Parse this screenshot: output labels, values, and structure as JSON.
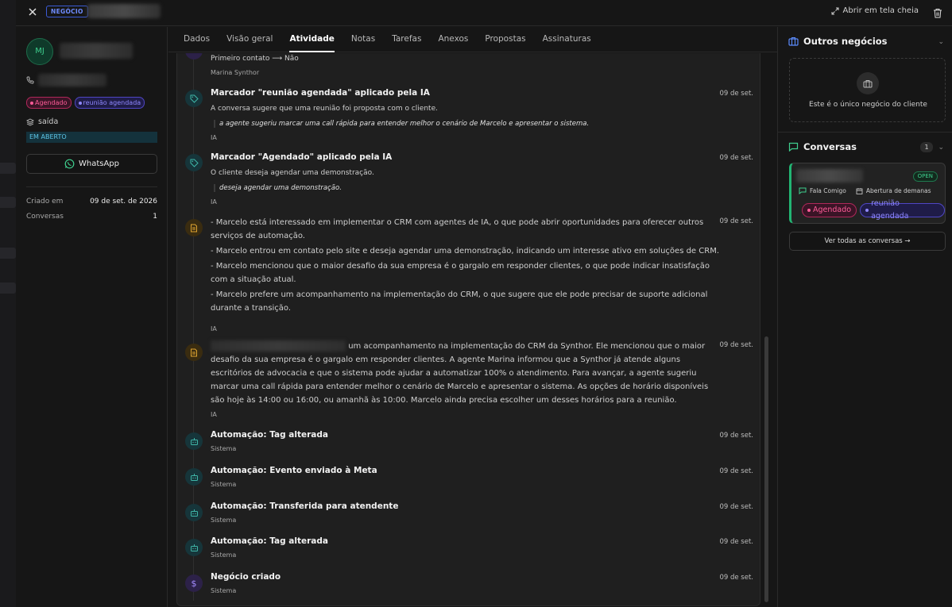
{
  "topbar": {
    "badge": "NEGÓCIO",
    "fullscreen_label": "Abrir em tela cheia"
  },
  "contact": {
    "initials": "MJ",
    "tags": [
      {
        "label": "Agendado",
        "color": "#ff5c98"
      },
      {
        "label": "reunião agendada",
        "color": "#8f88ff"
      }
    ],
    "stage": "saída",
    "status": "EM ABERTO",
    "whatsapp_label": "WhatsApp",
    "created_label": "Criado em",
    "created_value": "09 de set. de 2026",
    "conversations_label": "Conversas",
    "conversations_value": "1"
  },
  "tabs": [
    {
      "label": "Dados",
      "active": false
    },
    {
      "label": "Visão geral",
      "active": false
    },
    {
      "label": "Atividade",
      "active": true
    },
    {
      "label": "Notas",
      "active": false
    },
    {
      "label": "Tarefas",
      "active": false
    },
    {
      "label": "Anexos",
      "active": false
    },
    {
      "label": "Propostas",
      "active": false
    },
    {
      "label": "Assinaturas",
      "active": false
    }
  ],
  "timeline": {
    "partial_top": {
      "desc": "Primeiro contato ⟶ Não",
      "author": "Marina Synthor"
    },
    "entries": [
      {
        "title": "Marcador \"reunião agendada\" aplicado pela IA",
        "date": "09 de set.",
        "desc": "A conversa sugere que uma reunião foi proposta com o cliente.",
        "quote": "a agente sugeriu marcar uma call rápida para entender melhor o cenário de Marcelo e apresentar o sistema.",
        "author": "IA"
      },
      {
        "title": "Marcador \"Agendado\" aplicado pela IA",
        "date": "09 de set.",
        "desc": "O cliente deseja agendar uma demonstração.",
        "quote": "deseja agendar uma demonstração.",
        "author": "IA"
      },
      {
        "date": "09 de set.",
        "bullets": [
          "- Marcelo está interessado em implementar o CRM com agentes de IA, o que pode abrir oportunidades para oferecer outros serviços de automação.",
          "- Marcelo entrou em contato pelo site e deseja agendar uma demonstração, indicando um interesse ativo em soluções de CRM.",
          "- Marcelo mencionou que o maior desafio da sua empresa é o gargalo em responder clientes, o que pode indicar insatisfação com a situação atual.",
          "- Marcelo prefere um acompanhamento na implementação do CRM, o que sugere que ele pode precisar de suporte adicional durante a transição."
        ],
        "author": "IA"
      },
      {
        "date": "09 de set.",
        "summary": "um acompanhamento na implementação do CRM da Synthor. Ele mencionou que o maior desafio da sua empresa é o gargalo em responder clientes. A agente Marina informou que a Synthor já atende alguns escritórios de advocacia e que o sistema pode ajudar a automatizar 100% o atendimento. Para avançar, a agente sugeriu marcar uma call rápida para entender melhor o cenário de Marcelo e apresentar o sistema. As opções de horário disponíveis são hoje às 14:00 ou 16:00, ou amanhã às 10:00. Marcelo ainda precisa escolher um desses horários para a reunião.",
        "author": "IA"
      },
      {
        "title": "Automação: Tag alterada",
        "date": "09 de set.",
        "author": "Sistema"
      },
      {
        "title": "Automação: Evento enviado à Meta",
        "date": "09 de set.",
        "author": "Sistema"
      },
      {
        "title": "Automação: Transferida para atendente",
        "date": "09 de set.",
        "author": "Sistema"
      },
      {
        "title": "Automação: Tag alterada",
        "date": "09 de set.",
        "author": "Sistema"
      },
      {
        "title": "Negócio criado",
        "date": "09 de set.",
        "author": "Sistema"
      }
    ]
  },
  "right": {
    "other_deals_title": "Outros negócios",
    "other_deals_empty": "Este é o único negócio do cliente",
    "conversations_title": "Conversas",
    "conversations_count": "1",
    "conversation": {
      "status": "OPEN",
      "channel": "Fala Comigo",
      "department": "Abertura de demanas",
      "tags": [
        {
          "label": "Agendado",
          "color": "#ff5c98"
        },
        {
          "label": "reunião agendada",
          "color": "#8f88ff"
        }
      ]
    },
    "view_all_label": "Ver todas as conversas →"
  }
}
